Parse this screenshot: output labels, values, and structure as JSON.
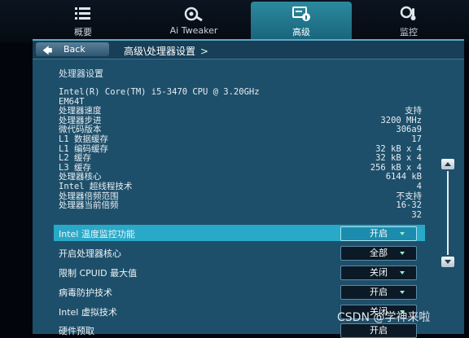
{
  "tabs": [
    {
      "label": "概要",
      "icon": "list-icon",
      "active": false
    },
    {
      "label": "Ai Tweaker",
      "icon": "tweaker-icon",
      "active": false
    },
    {
      "label": "高级",
      "icon": "advanced-icon",
      "active": true
    },
    {
      "label": "监控",
      "icon": "thermometer-icon",
      "active": false
    }
  ],
  "back_label": "Back",
  "breadcrumb": {
    "parent": "高级\\",
    "current": "处理器设置",
    "trail": ">"
  },
  "section_title": "处理器设置",
  "info_rows": [
    {
      "label": "Intel(R) Core(TM) i5-3470 CPU @ 3.20GHz",
      "value": ""
    },
    {
      "label": "EM64T",
      "value": ""
    },
    {
      "label": "处理器速度",
      "value": "支持"
    },
    {
      "label": "处理器步进",
      "value": "3200 MHz"
    },
    {
      "label": "微代码版本",
      "value": "306a9"
    },
    {
      "label": "L1 数据缓存",
      "value": "17"
    },
    {
      "label": "L1 编码缓存",
      "value": "32 kB x 4"
    },
    {
      "label": "L2 缓存",
      "value": "32 kB x 4"
    },
    {
      "label": "L3 缓存",
      "value": "256 kB x 4"
    },
    {
      "label": "处理器核心",
      "value": "6144 kB"
    },
    {
      "label": "Intel 超线程技术",
      "value": "4"
    },
    {
      "label": "处理器倍频范围",
      "value": "不支持"
    },
    {
      "label": "处理器当前倍频",
      "value": "16-32"
    },
    {
      "label": "",
      "value": "32"
    }
  ],
  "options": [
    {
      "label": "Intel 温度监控功能",
      "value": "开启",
      "selected": true
    },
    {
      "label": "开启处理器核心",
      "value": "全部",
      "selected": false
    },
    {
      "label": "限制 CPUID 最大值",
      "value": "关闭",
      "selected": false
    },
    {
      "label": "病毒防护技术",
      "value": "开启",
      "selected": false
    },
    {
      "label": "Intel 虚拟技术",
      "value": "关闭",
      "selected": false
    },
    {
      "label": "硬件预取",
      "value": "开启",
      "selected": false
    }
  ],
  "watermark": "CSDN @学神来啦",
  "colors": {
    "accent": "#28a9c8",
    "panel": "#1e4f6a",
    "active_tab": "#1f7890"
  }
}
